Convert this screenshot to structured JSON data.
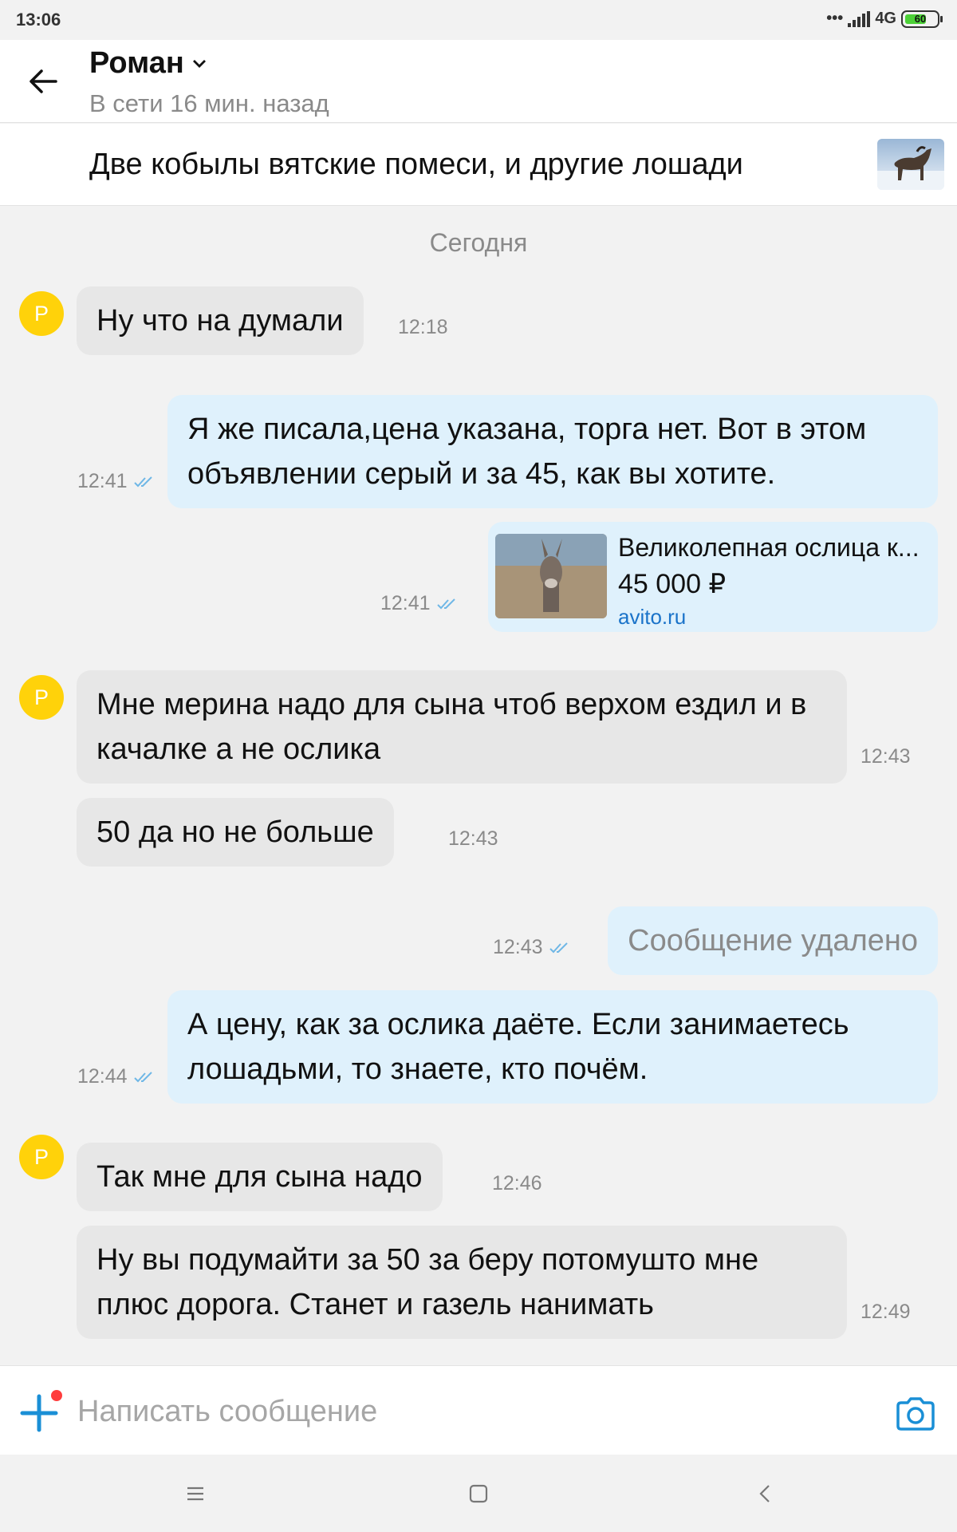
{
  "status_bar": {
    "time": "13:06",
    "network": "4G",
    "battery": "60"
  },
  "header": {
    "contact_name": "Роман",
    "online_status": "В сети 16 мин. назад"
  },
  "ad": {
    "title": "Две кобылы вятские помеси, и другие лошади"
  },
  "date_separator": "Сегодня",
  "avatar_letter": "Р",
  "messages": [
    {
      "dir": "in",
      "text": "Ну что на думали",
      "time": "12:18"
    },
    {
      "dir": "out",
      "text": "Я же писала,цена указана, торга нет. Вот в этом объявлении серый и за 45, как вы хотите.",
      "time": "12:41"
    },
    {
      "dir": "out",
      "type": "link",
      "title": "Великолепная ослица к...",
      "price": "45 000 ₽",
      "domain": "avito.ru",
      "time": "12:41"
    },
    {
      "dir": "in",
      "text": "Мне мерина надо для сына чтоб верхом ездил и в качалке  а не ослика",
      "time": "12:43"
    },
    {
      "dir": "in",
      "text": "50  да  но не больше",
      "time": "12:43"
    },
    {
      "dir": "out",
      "text": "Сообщение удалено",
      "time": "12:43"
    },
    {
      "dir": "out",
      "text": "А цену, как за ослика даёте. Если занимаетесь лошадьми, то знаете, кто почём.",
      "time": "12:44"
    },
    {
      "dir": "in",
      "text": "Так мне для сына надо",
      "time": "12:46"
    },
    {
      "dir": "in",
      "text": "Ну вы подумайти за 50 за беру потомушто мне плюс дорога. Станет и газель нанимать",
      "time": "12:49"
    }
  ],
  "composer": {
    "placeholder": "Написать сообщение"
  },
  "colors": {
    "accent": "#1a8fd6",
    "avatar": "#ffd20a",
    "outgoing_bubble": "#dff1fc",
    "incoming_bubble": "#e7e7e7"
  }
}
